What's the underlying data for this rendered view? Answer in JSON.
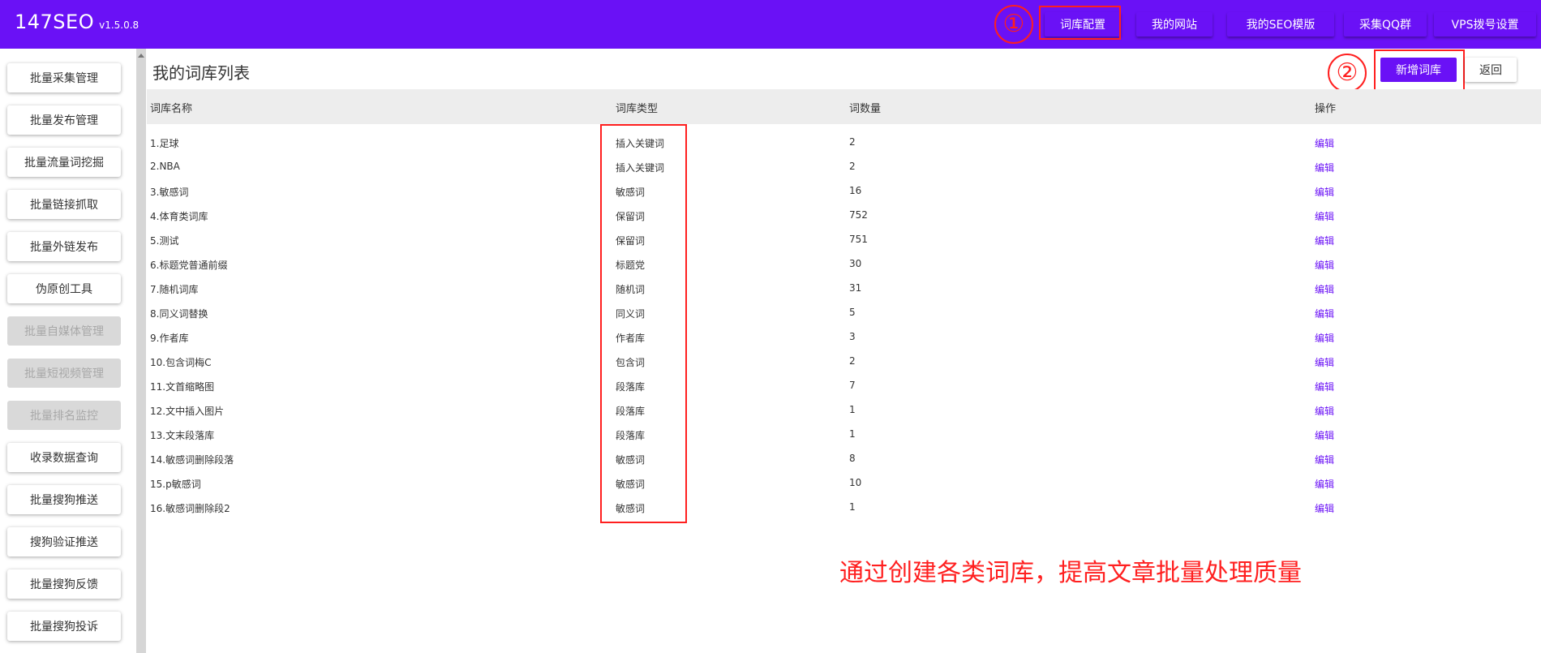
{
  "app": {
    "name": "147SEO",
    "version": "v1.5.0.8"
  },
  "top_nav": [
    {
      "label": "词库配置"
    },
    {
      "label": "我的网站"
    },
    {
      "label": "我的SEO模版"
    },
    {
      "label": "采集QQ群"
    },
    {
      "label": "VPS拨号设置"
    }
  ],
  "sidebar": {
    "items": [
      {
        "label": "批量采集管理",
        "disabled": false
      },
      {
        "label": "批量发布管理",
        "disabled": false
      },
      {
        "label": "批量流量词挖掘",
        "disabled": false
      },
      {
        "label": "批量链接抓取",
        "disabled": false
      },
      {
        "label": "批量外链发布",
        "disabled": false
      },
      {
        "label": "伪原创工具",
        "disabled": false
      },
      {
        "label": "批量自媒体管理",
        "disabled": true
      },
      {
        "label": "批量短视频管理",
        "disabled": true
      },
      {
        "label": "批量排名监控",
        "disabled": true
      },
      {
        "label": "收录数据查询",
        "disabled": false
      },
      {
        "label": "批量搜狗推送",
        "disabled": false
      },
      {
        "label": "搜狗验证推送",
        "disabled": false
      },
      {
        "label": "批量搜狗反馈",
        "disabled": false
      },
      {
        "label": "批量搜狗投诉",
        "disabled": false
      }
    ]
  },
  "main": {
    "title": "我的词库列表",
    "add_button": "新增词库",
    "back_button": "返回",
    "table": {
      "headers": [
        "词库名称",
        "词库类型",
        "词数量",
        "操作"
      ],
      "rows": [
        {
          "name": "1.足球",
          "type": "插入关键词",
          "count": "2",
          "action": "编辑"
        },
        {
          "name": "2.NBA",
          "type": "插入关键词",
          "count": "2",
          "action": "编辑"
        },
        {
          "name": "3.敏感词",
          "type": "敏感词",
          "count": "16",
          "action": "编辑"
        },
        {
          "name": "4.体育类词库",
          "type": "保留词",
          "count": "752",
          "action": "编辑"
        },
        {
          "name": "5.测试",
          "type": "保留词",
          "count": "751",
          "action": "编辑"
        },
        {
          "name": "6.标题党普通前缀",
          "type": "标题党",
          "count": "30",
          "action": "编辑"
        },
        {
          "name": "7.随机词库",
          "type": "随机词",
          "count": "31",
          "action": "编辑"
        },
        {
          "name": "8.同义词替换",
          "type": "同义词",
          "count": "5",
          "action": "编辑"
        },
        {
          "name": "9.作者库",
          "type": "作者库",
          "count": "3",
          "action": "编辑"
        },
        {
          "name": "10.包含词梅C",
          "type": "包含词",
          "count": "2",
          "action": "编辑"
        },
        {
          "name": "11.文首缩略图",
          "type": "段落库",
          "count": "7",
          "action": "编辑"
        },
        {
          "name": "12.文中插入图片",
          "type": "段落库",
          "count": "1",
          "action": "编辑"
        },
        {
          "name": "13.文末段落库",
          "type": "段落库",
          "count": "1",
          "action": "编辑"
        },
        {
          "name": "14.敏感词删除段落",
          "type": "敏感词",
          "count": "8",
          "action": "编辑"
        },
        {
          "name": "15.p敏感词",
          "type": "敏感词",
          "count": "10",
          "action": "编辑"
        },
        {
          "name": "16.敏感词删除段2",
          "type": "敏感词",
          "count": "1",
          "action": "编辑"
        }
      ]
    }
  },
  "annotations": {
    "marker_1": "①",
    "marker_2": "②",
    "caption": "通过创建各类词库，提高文章批量处理质量"
  },
  "colors": {
    "brand": "#6a11f6",
    "annotation": "#ff1f1f",
    "header_bg": "#ededed"
  }
}
